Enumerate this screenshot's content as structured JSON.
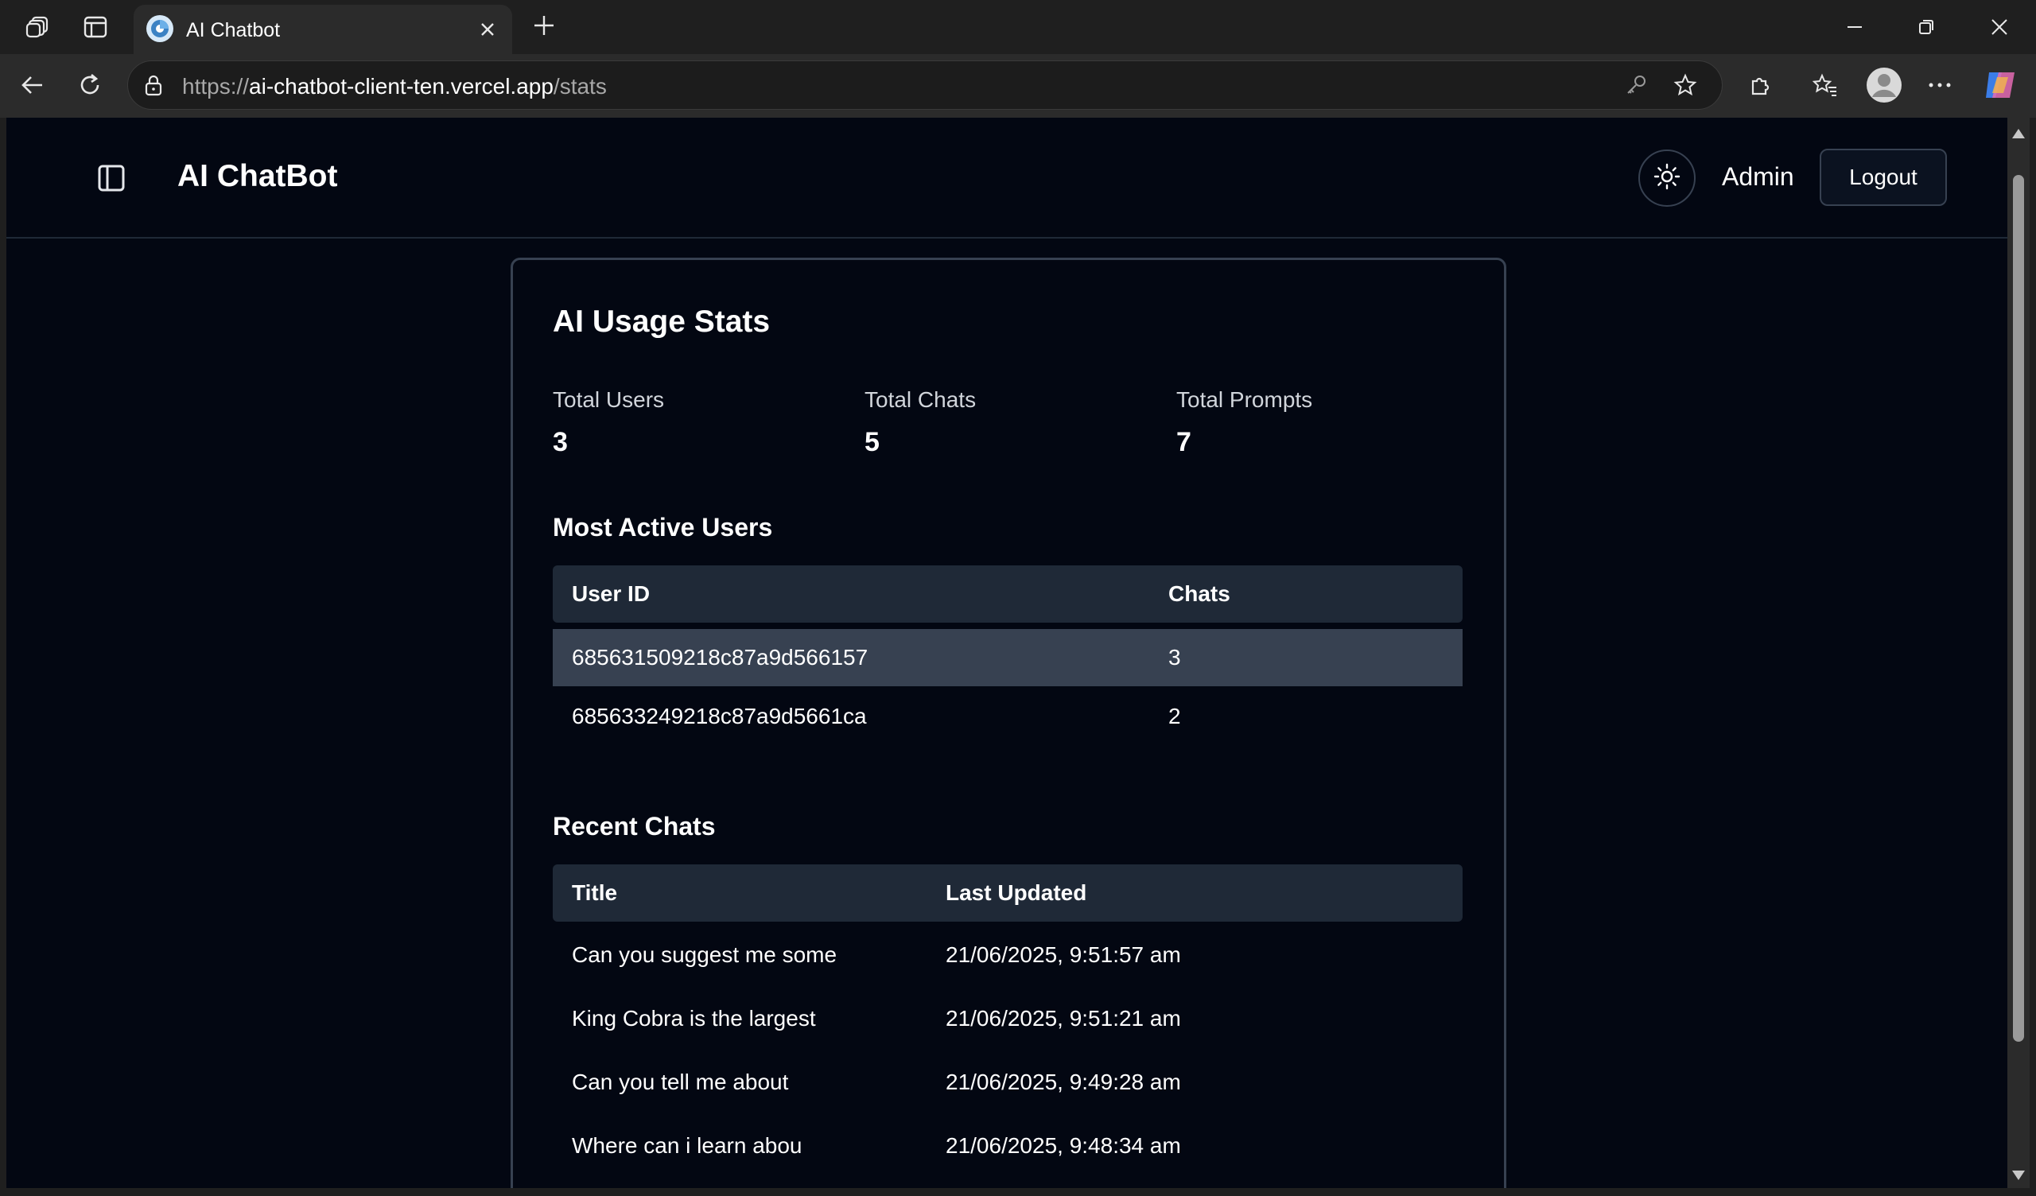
{
  "browser": {
    "tab_title": "AI Chatbot",
    "url_proto": "https://",
    "url_host": "ai-chatbot-client-ten.vercel.app",
    "url_path": "/stats"
  },
  "header": {
    "app_title": "AI ChatBot",
    "user_label": "Admin",
    "logout_label": "Logout"
  },
  "stats": {
    "title": "AI Usage Stats",
    "items": [
      {
        "label": "Total Users",
        "value": "3"
      },
      {
        "label": "Total Chats",
        "value": "5"
      },
      {
        "label": "Total Prompts",
        "value": "7"
      }
    ]
  },
  "active_users": {
    "title": "Most Active Users",
    "columns": [
      "User ID",
      "Chats"
    ],
    "rows": [
      {
        "user_id": "685631509218c87a9d566157",
        "chats": "3"
      },
      {
        "user_id": "685633249218c87a9d5661ca",
        "chats": "2"
      }
    ]
  },
  "recent_chats": {
    "title": "Recent Chats",
    "columns": [
      "Title",
      "Last Updated"
    ],
    "rows": [
      {
        "title": "Can you suggest me some",
        "updated": "21/06/2025, 9:51:57 am"
      },
      {
        "title": "King Cobra is the largest",
        "updated": "21/06/2025, 9:51:21 am"
      },
      {
        "title": "Can you tell me about",
        "updated": "21/06/2025, 9:49:28 am"
      },
      {
        "title": "Where can i learn abou",
        "updated": "21/06/2025, 9:48:34 am"
      }
    ]
  }
}
